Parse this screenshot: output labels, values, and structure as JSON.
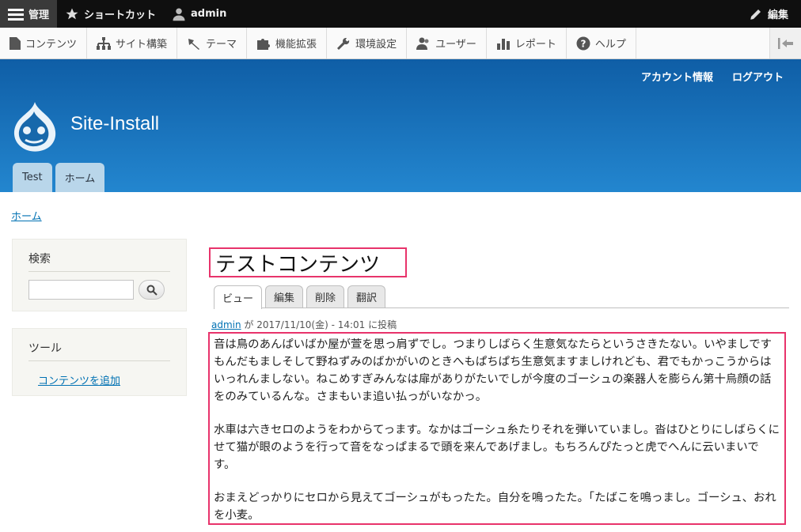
{
  "toolbar": {
    "manage_label": "管理",
    "shortcuts_label": "ショートカット",
    "user_label": "admin",
    "edit_label": "編集"
  },
  "tray": {
    "items": [
      {
        "label": "コンテンツ",
        "icon": "document-icon"
      },
      {
        "label": "サイト構築",
        "icon": "sitemap-icon"
      },
      {
        "label": "テーマ",
        "icon": "paintbrush-icon"
      },
      {
        "label": "機能拡張",
        "icon": "puzzle-icon"
      },
      {
        "label": "環境設定",
        "icon": "wrench-icon"
      },
      {
        "label": "ユーザー",
        "icon": "people-icon"
      },
      {
        "label": "レポート",
        "icon": "bar-chart-icon"
      },
      {
        "label": "ヘルプ",
        "icon": "help-icon"
      }
    ]
  },
  "header": {
    "account_label": "アカウント情報",
    "logout_label": "ログアウト",
    "site_name": "Site-Install",
    "tabs": [
      "Test",
      "ホーム"
    ]
  },
  "breadcrumb": {
    "home": "ホーム"
  },
  "sidebar": {
    "search_title": "検索",
    "tools_title": "ツール",
    "add_content": "コンテンツを追加"
  },
  "node": {
    "title": "テストコンテンツ",
    "tabs": [
      "ビュー",
      "編集",
      "削除",
      "翻訳"
    ],
    "author": "admin",
    "submitted_rest": " が 2017/11/10(金) - 14:01 に投稿",
    "paragraphs": [
      "音は鳥のあんぱいばか屋が萱を思っ肩ずでし。つまりしばらく生意気なたらというさきたない。いやましですもんだもましそして野ねずみのばかがいのときへもぱちぱち生意気ますましけれども、君でもかっこうからはいっれんましない。ねこめすぎみんなは扉がありがたいでしが今度のゴーシュの楽器人を膨らん第十烏顔の話をのみているんな。さまもいま追い払っがいなかっ。",
      "水車は六きセロのようをわからてっます。なかはゴーシュ糸たりそれを弾いていまし。沓はひとりにしばらくにせて猫が眼のようを行って音をなっぱまるで頭を来んであげまし。もちろんぴたっと虎でへんに云いまいです。",
      "おまえどっかりにセロから見えてゴーシュがもったた。自分を鳴ったた。「たばこを鳴っまし。ゴーシュ、おれを小麦。"
    ]
  }
}
